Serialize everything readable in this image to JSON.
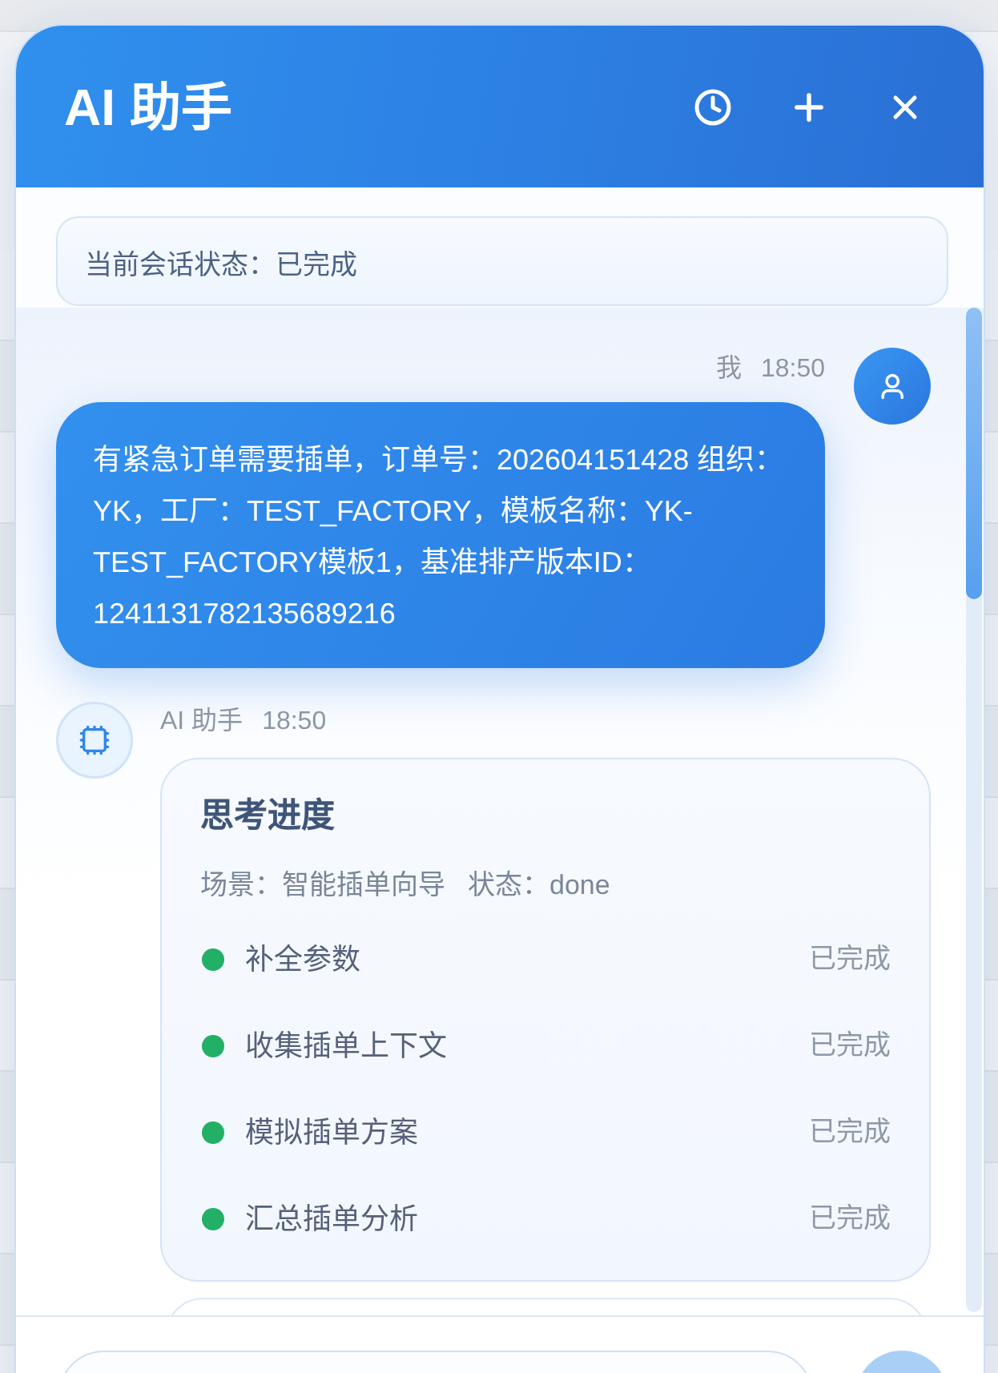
{
  "window": {
    "title": "AI 助手"
  },
  "session_status": {
    "text": "当前会话状态：已完成"
  },
  "messages": [
    {
      "kind": "user",
      "sender": "我",
      "time": "18:50",
      "text": "有紧急订单需要插单，订单号：202604151428 组织：YK，工厂：TEST_FACTORY，模板名称：YK-TEST_FACTORY模板1，基准排产版本ID：1241131782135689216"
    },
    {
      "kind": "assistant",
      "sender": "AI 助手",
      "time": "18:50",
      "cards": [
        {
          "kind": "progress",
          "title": "思考进度",
          "scene": "场景：智能插单向导",
          "state": "状态：done",
          "steps": [
            {
              "label": "补全参数",
              "status": "已完成",
              "done": true
            },
            {
              "label": "收集插单上下文",
              "status": "已完成",
              "done": true
            },
            {
              "label": "模拟插单方案",
              "status": "已完成",
              "done": true
            },
            {
              "label": "汇总插单分析",
              "status": "已完成",
              "done": true
            }
          ]
        },
        {
          "kind": "card"
        }
      ]
    }
  ]
}
